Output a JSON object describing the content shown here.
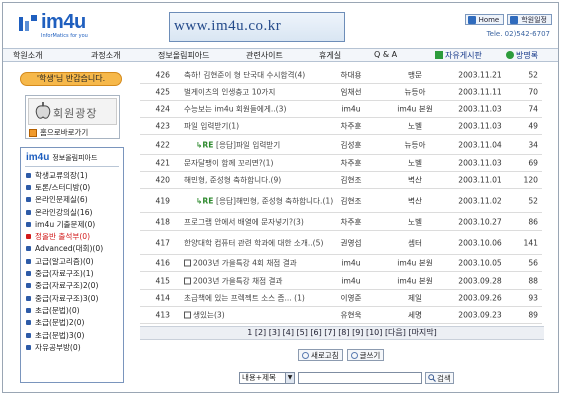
{
  "header": {
    "logo_text": "im4u",
    "logo_tagline": "InforMatics for you",
    "banner_text": "www.im4u.co.kr",
    "home_label": "Home",
    "school_label": "학원일정",
    "tel": "Tele. 02)542-6707"
  },
  "nav": {
    "items": [
      "학원소개",
      "과정소개",
      "정보올림피아드",
      "관련사이트",
      "휴게실",
      "Q & A",
      "자유게시판",
      "방명록"
    ]
  },
  "sidebar": {
    "welcome": "'학생'님 반갑습니다.",
    "club_label": "회원광장",
    "shortcut_label": "홈으로바로가기",
    "board_logo": "im4u",
    "board_title": "정보올림피아드",
    "links": [
      "학생교류의장(1)",
      "토론/스터디방(0)",
      "온라인문제실(6)",
      "온라인강의실(16)",
      "im4u 기출문제(0)",
      "정올반 출석부(0)",
      "Advanced(대회)(0)",
      "고급(알고리즘)(0)",
      "중급(자료구조)(1)",
      "중급(자료구조)2(0)",
      "중급(자료구조)3(0)",
      "초급(문법)(0)",
      "초급(문법)2(0)",
      "초급(문법)3(0)",
      "자유공부방(0)"
    ]
  },
  "posts": [
    {
      "num": "426",
      "title": "축하! 김현준이 형 단국대 수시합격(4)",
      "author": "하대용",
      "category": "맹문",
      "date": "2003.11.21",
      "hits": "52",
      "reply": false,
      "disk": false
    },
    {
      "num": "425",
      "title": "벌게이츠의 인생충고 10가지",
      "author": "임채선",
      "category": "뉴등아",
      "date": "2003.11.11",
      "hits": "70",
      "reply": false,
      "disk": false
    },
    {
      "num": "424",
      "title": "수능보는 im4u 회원들에게..(3)",
      "author": "im4u",
      "category": "im4u 본원",
      "date": "2003.11.03",
      "hits": "74",
      "reply": false,
      "disk": false
    },
    {
      "num": "423",
      "title": "파일 입력받기(1)",
      "author": "차주훈",
      "category": "노벨",
      "date": "2003.11.03",
      "hits": "49",
      "reply": false,
      "disk": false
    },
    {
      "num": "422",
      "title": "[응답]파일 입력받기",
      "author": "김성훈",
      "category": "뉴등아",
      "date": "2003.11.04",
      "hits": "34",
      "reply": true,
      "disk": false
    },
    {
      "num": "421",
      "title": "문자달팽이 함께 꼬리면?(1)",
      "author": "차주훈",
      "category": "노벨",
      "date": "2003.11.03",
      "hits": "69",
      "reply": false,
      "disk": false
    },
    {
      "num": "420",
      "title": "해민형, 준성형 축하합니다.(9)",
      "author": "김현조",
      "category": "벽산",
      "date": "2003.11.01",
      "hits": "120",
      "reply": false,
      "disk": false
    },
    {
      "num": "419",
      "title": "[응답]해민형, 준성형 축하합니다.(1)",
      "author": "김현조",
      "category": "벽산",
      "date": "2003.11.02",
      "hits": "52",
      "reply": true,
      "disk": false
    },
    {
      "num": "418",
      "title": "프로그램 안에서 배열에 문자넣기?(3)",
      "author": "차주훈",
      "category": "노벨",
      "date": "2003.10.27",
      "hits": "86",
      "reply": false,
      "disk": false
    },
    {
      "num": "417",
      "title": "한양대학 컴퓨터 관련 학과에 대한 소개..(5)",
      "author": "권영섭",
      "category": "셈터",
      "date": "2003.10.06",
      "hits": "141",
      "reply": false,
      "disk": false
    },
    {
      "num": "416",
      "title": "2003년 가을특강 4회 채점 결과",
      "author": "im4u",
      "category": "im4u 본원",
      "date": "2003.10.05",
      "hits": "56",
      "reply": false,
      "disk": true
    },
    {
      "num": "415",
      "title": "2003년 가을특강 채점 결과",
      "author": "im4u",
      "category": "im4u 본원",
      "date": "2003.09.28",
      "hits": "88",
      "reply": false,
      "disk": true
    },
    {
      "num": "414",
      "title": "초급책에 있는 프렉젝트 소스 좀... (1)",
      "author": "이영준",
      "category": "제일",
      "date": "2003.09.26",
      "hits": "93",
      "reply": false,
      "disk": false
    },
    {
      "num": "413",
      "title": "생있는(3)",
      "author": "유현욱",
      "category": "세명",
      "date": "2003.09.23",
      "hits": "89",
      "reply": false,
      "disk": true
    }
  ],
  "pagination": {
    "pages": [
      "1",
      "[2]",
      "[3]",
      "[4]",
      "[5]",
      "[6]",
      "[7]",
      "[8]",
      "[9]",
      "[10]",
      "[다음]",
      "[마지막]"
    ]
  },
  "actions": {
    "refresh_label": "새로고침",
    "write_label": "글쓰기"
  },
  "search": {
    "field_value": "내용+제목",
    "button_label": "검색"
  },
  "colors": {
    "accent": "#1f5fbf",
    "welcome_bg": "#f6b84a",
    "reply_tag": "#2e8a2e",
    "highlight_link": "#d21a1a"
  }
}
